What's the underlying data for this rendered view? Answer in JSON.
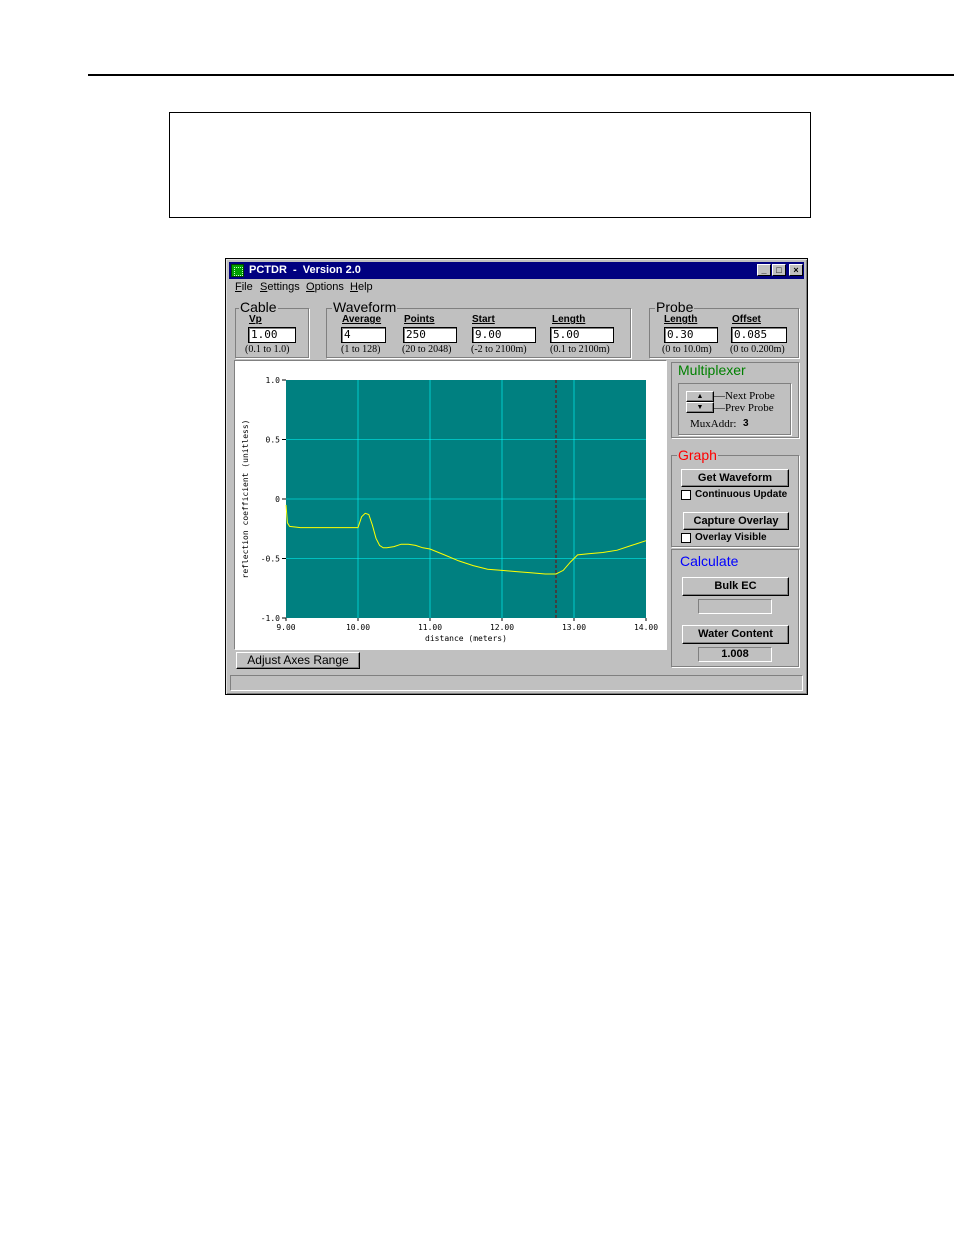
{
  "window": {
    "title": "PCTDR  -  Version 2.0",
    "buttons": [
      "_",
      "□",
      "×"
    ]
  },
  "menu": [
    {
      "label": "File",
      "key": "F"
    },
    {
      "label": "Settings",
      "key": "S"
    },
    {
      "label": "Options",
      "key": "O"
    },
    {
      "label": "Help",
      "key": "H"
    }
  ],
  "cable": {
    "title": "Cable",
    "vp_label": "Vp",
    "vp_value": "1.00",
    "vp_range": "(0.1 to 1.0)"
  },
  "waveform": {
    "title": "Waveform",
    "average_label": "Average",
    "average_value": "4",
    "average_range": "(1 to 128)",
    "points_label": "Points",
    "points_value": "250",
    "points_range": "(20 to 2048)",
    "start_label": "Start",
    "start_value": "9.00",
    "start_range": "(-2 to 2100m)",
    "length_label": "Length",
    "length_value": "5.00",
    "length_range": "(0.1 to 2100m)"
  },
  "probe": {
    "title": "Probe",
    "length_label": "Length",
    "length_value": "0.30",
    "length_range": "(0 to 10.0m)",
    "offset_label": "Offset",
    "offset_value": "0.085",
    "offset_range": "(0 to 0.200m)"
  },
  "multiplexer": {
    "title": "Multiplexer",
    "next_label": "Next Probe",
    "prev_label": "Prev Probe",
    "addr_label": "MuxAddr:",
    "addr_value": "3"
  },
  "graph": {
    "title": "Graph",
    "get_waveform": "Get Waveform",
    "continuous_update": "Continuous Update",
    "capture_overlay": "Capture Overlay",
    "overlay_visible": "Overlay Visible"
  },
  "calculate": {
    "title": "Calculate",
    "bulk_ec": "Bulk EC",
    "bulk_ec_value": "",
    "water_content": "Water Content",
    "water_content_value": "1.008"
  },
  "adjust_axes": "Adjust Axes Range",
  "colors": {
    "plot_bg": "#008080",
    "grid": "#00ffff",
    "trace": "#ffff00",
    "marker": "#800000",
    "multiplexer_title": "#008000",
    "graph_title": "#ff0000",
    "calculate_title": "#0000ff"
  },
  "chart_data": {
    "type": "line",
    "xlabel": "distance (meters)",
    "ylabel": "reflection coefficient (unitless)",
    "xlim": [
      9.0,
      14.0
    ],
    "ylim": [
      -1.0,
      1.0
    ],
    "x_ticks": [
      "9.00",
      "10.00",
      "11.00",
      "12.00",
      "13.00",
      "14.00"
    ],
    "y_ticks": [
      "1.0",
      "0.5",
      "0",
      "-0.5",
      "-1.0"
    ],
    "grid": true,
    "marker_x": 12.75,
    "series": [
      {
        "x": [
          9.0,
          9.02,
          9.05,
          9.2,
          9.5,
          9.8,
          10.0,
          10.05,
          10.1,
          10.15,
          10.2,
          10.25,
          10.3,
          10.35,
          10.4,
          10.5,
          10.6,
          10.7,
          10.8,
          10.9,
          11.0,
          11.2,
          11.4,
          11.6,
          11.8,
          12.0,
          12.2,
          12.4,
          12.6,
          12.75,
          12.85,
          12.95,
          13.05,
          13.2,
          13.4,
          13.6,
          13.8,
          14.0
        ],
        "y": [
          -0.05,
          -0.2,
          -0.23,
          -0.24,
          -0.24,
          -0.24,
          -0.24,
          -0.15,
          -0.12,
          -0.13,
          -0.22,
          -0.33,
          -0.39,
          -0.41,
          -0.41,
          -0.4,
          -0.38,
          -0.38,
          -0.39,
          -0.41,
          -0.42,
          -0.47,
          -0.52,
          -0.56,
          -0.59,
          -0.6,
          -0.61,
          -0.62,
          -0.63,
          -0.63,
          -0.6,
          -0.53,
          -0.47,
          -0.46,
          -0.45,
          -0.43,
          -0.39,
          -0.35
        ]
      }
    ]
  }
}
